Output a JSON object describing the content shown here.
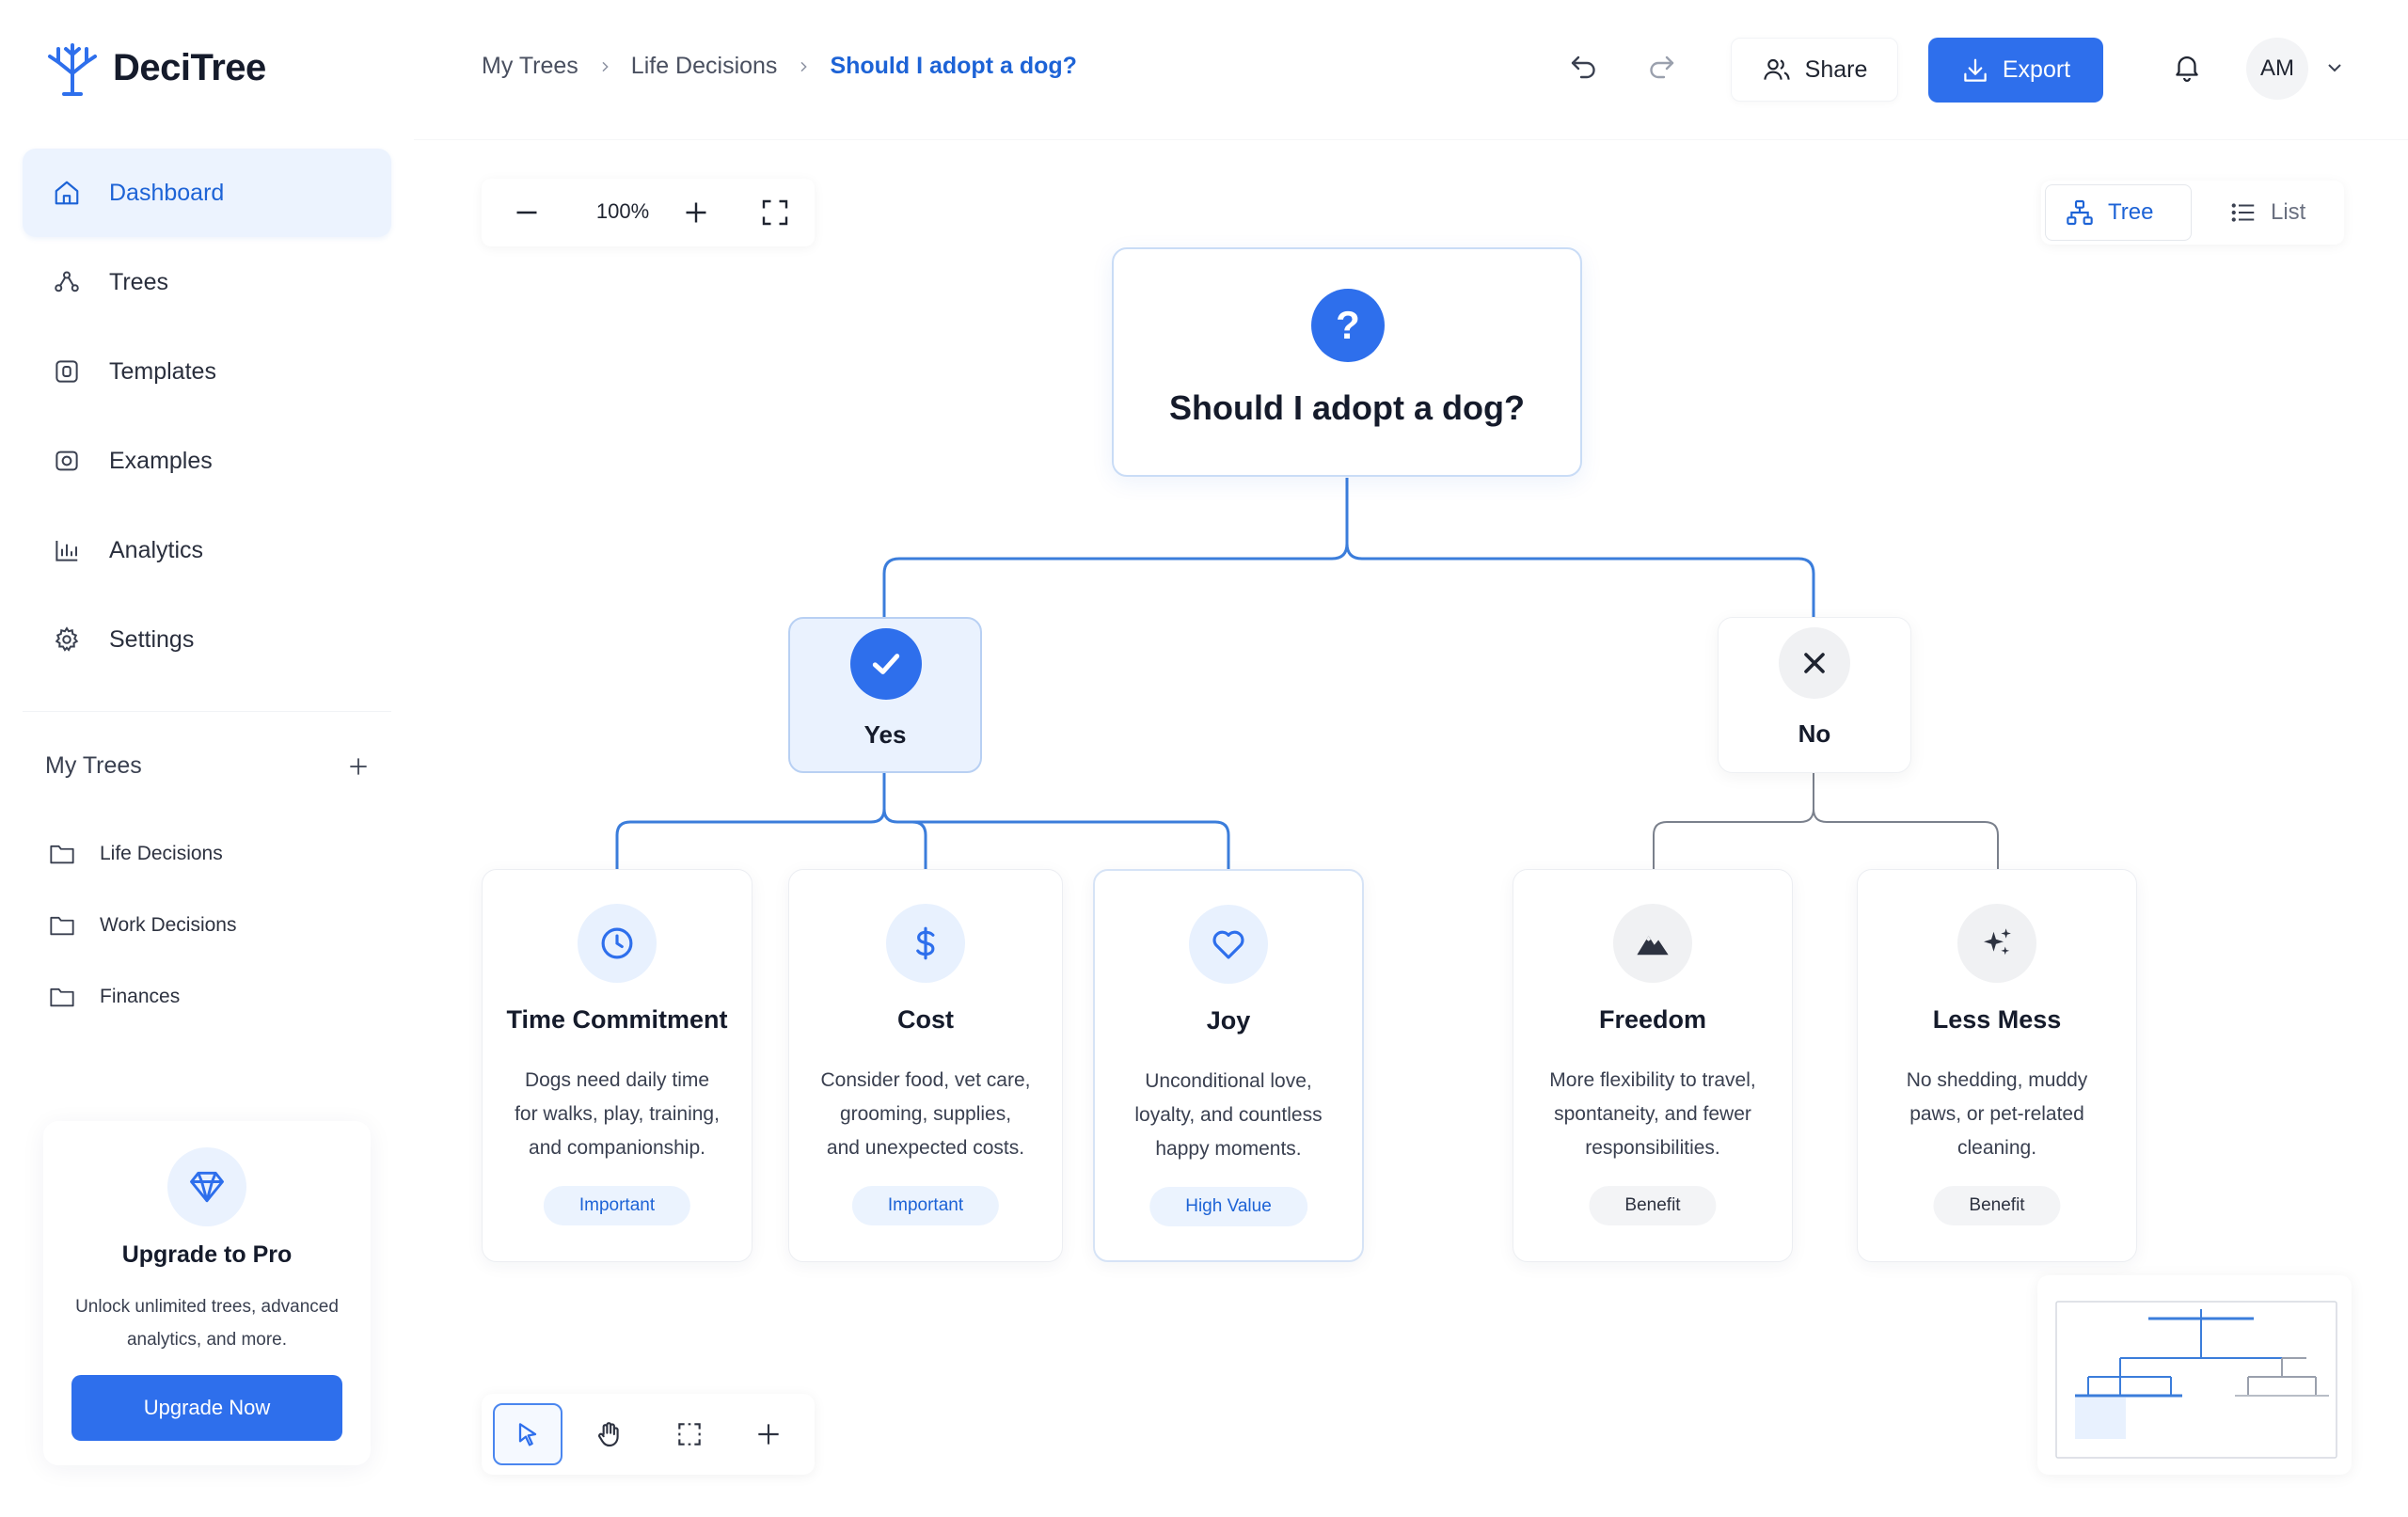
{
  "app": {
    "name": "DeciTree"
  },
  "sidebar": {
    "nav": [
      {
        "label": "Dashboard",
        "icon": "home-icon",
        "active": true
      },
      {
        "label": "Trees",
        "icon": "tree-nodes-icon"
      },
      {
        "label": "Templates",
        "icon": "template-icon"
      },
      {
        "label": "Examples",
        "icon": "camera-icon"
      },
      {
        "label": "Analytics",
        "icon": "bar-chart-icon"
      },
      {
        "label": "Settings",
        "icon": "gear-icon"
      }
    ],
    "my_trees": {
      "title": "My Trees",
      "items": [
        "Life Decisions",
        "Work Decisions",
        "Finances"
      ]
    },
    "upgrade": {
      "title": "Upgrade to Pro",
      "desc_line1": "Unlock unlimited trees, advanced",
      "desc_line2": "analytics, and more.",
      "button": "Upgrade Now"
    }
  },
  "header": {
    "breadcrumb": [
      "My Trees",
      "Life Decisions",
      "Should I adopt a dog?"
    ],
    "share": "Share",
    "export": "Export",
    "avatar": "AM"
  },
  "canvas": {
    "zoom": "100%",
    "views": [
      "Tree",
      "List"
    ],
    "active_view": "Tree"
  },
  "tree": {
    "root": {
      "title": "Should I adopt a dog?",
      "icon": "question-icon"
    },
    "branches": [
      {
        "label": "Yes",
        "icon": "check-icon",
        "leaves": [
          {
            "title": "Time Commitment",
            "icon": "clock-icon",
            "desc": [
              "Dogs need daily time",
              "for walks, play, training,",
              "and companionship."
            ],
            "badge": "Important"
          },
          {
            "title": "Cost",
            "icon": "dollar-icon",
            "desc": [
              "Consider food, vet care,",
              "grooming, supplies,",
              "and unexpected costs."
            ],
            "badge": "Important"
          },
          {
            "title": "Joy",
            "icon": "heart-icon",
            "desc": [
              "Unconditional love,",
              "loyalty, and countless",
              "happy moments."
            ],
            "badge": "High Value"
          }
        ]
      },
      {
        "label": "No",
        "icon": "x-icon",
        "leaves": [
          {
            "title": "Freedom",
            "icon": "mountain-icon",
            "desc": [
              "More flexibility to travel,",
              "spontaneity, and fewer",
              "responsibilities."
            ],
            "badge": "Benefit"
          },
          {
            "title": "Less Mess",
            "icon": "sparkles-icon",
            "desc": [
              "No shedding, muddy",
              "paws, or pet-related",
              "cleaning."
            ],
            "badge": "Benefit"
          }
        ]
      }
    ]
  },
  "colors": {
    "accent": "#2e6fec",
    "accent_text": "#1d63d6",
    "edge_yes": "#3b7ddb",
    "edge_no": "#7a808c"
  }
}
